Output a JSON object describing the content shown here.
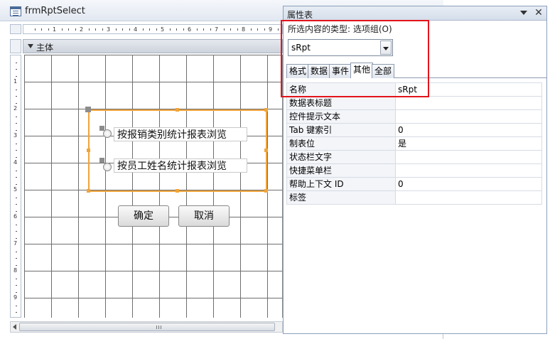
{
  "form_window": {
    "title": "frmRptSelect",
    "section_label": "主体",
    "ruler_h": [
      "1",
      "2",
      "3",
      "4",
      "5",
      "6",
      "7",
      "8",
      "9"
    ],
    "ruler_v": [
      "1",
      "2",
      "3",
      "4",
      "5",
      "6",
      "7",
      "8",
      "9"
    ],
    "options": [
      {
        "label": "按报销类别统计报表浏览"
      },
      {
        "label": "按员工姓名统计报表浏览"
      }
    ],
    "buttons": {
      "ok": "确定",
      "cancel": "取消"
    }
  },
  "property_sheet": {
    "title": "属性表",
    "selection_type_label": "所选内容的类型: 选项组(O)",
    "selected_object": "sRpt",
    "tabs": [
      {
        "label": "格式",
        "active": false
      },
      {
        "label": "数据",
        "active": false
      },
      {
        "label": "事件",
        "active": false
      },
      {
        "label": "其他",
        "active": true
      },
      {
        "label": "全部",
        "active": false
      }
    ],
    "rows": [
      {
        "name": "名称",
        "value": "sRpt"
      },
      {
        "name": "数据表标题",
        "value": ""
      },
      {
        "name": "控件提示文本",
        "value": ""
      },
      {
        "name": "Tab 键索引",
        "value": "0"
      },
      {
        "name": "制表位",
        "value": "是"
      },
      {
        "name": "状态栏文字",
        "value": ""
      },
      {
        "name": "快捷菜单栏",
        "value": ""
      },
      {
        "name": "帮助上下文 ID",
        "value": "0"
      },
      {
        "name": "标签",
        "value": ""
      }
    ]
  },
  "colors": {
    "highlight": "#e3141b",
    "selection_border": "#f0a43a",
    "grid_line": "#6e6e6e"
  }
}
